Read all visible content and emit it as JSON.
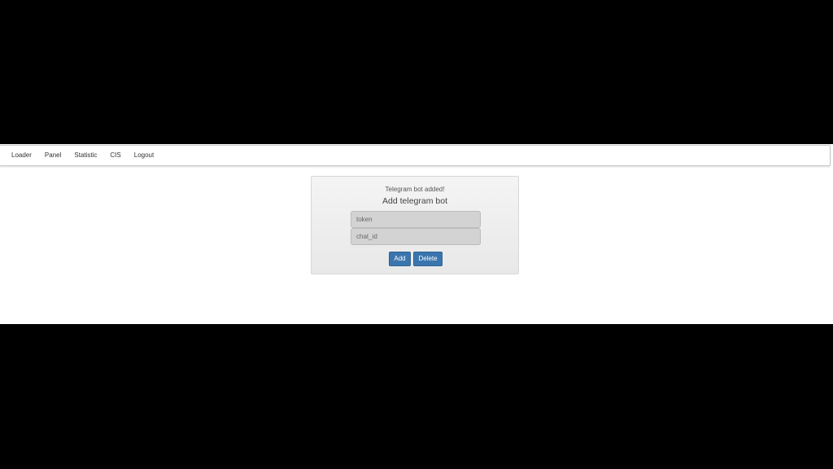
{
  "nav": {
    "items": [
      {
        "label": "Loader"
      },
      {
        "label": "Panel"
      },
      {
        "label": "Statistic"
      },
      {
        "label": "CIS"
      },
      {
        "label": "Logout"
      }
    ]
  },
  "form": {
    "status_message": "Telegram bot added!",
    "title": "Add telegram bot",
    "token_placeholder": "token",
    "chat_id_placeholder": "chat_id",
    "add_label": "Add",
    "delete_label": "Delete"
  },
  "colors": {
    "button_primary": "#3a75ad",
    "panel_background": "#eeeeee",
    "letterbox": "#000000"
  }
}
